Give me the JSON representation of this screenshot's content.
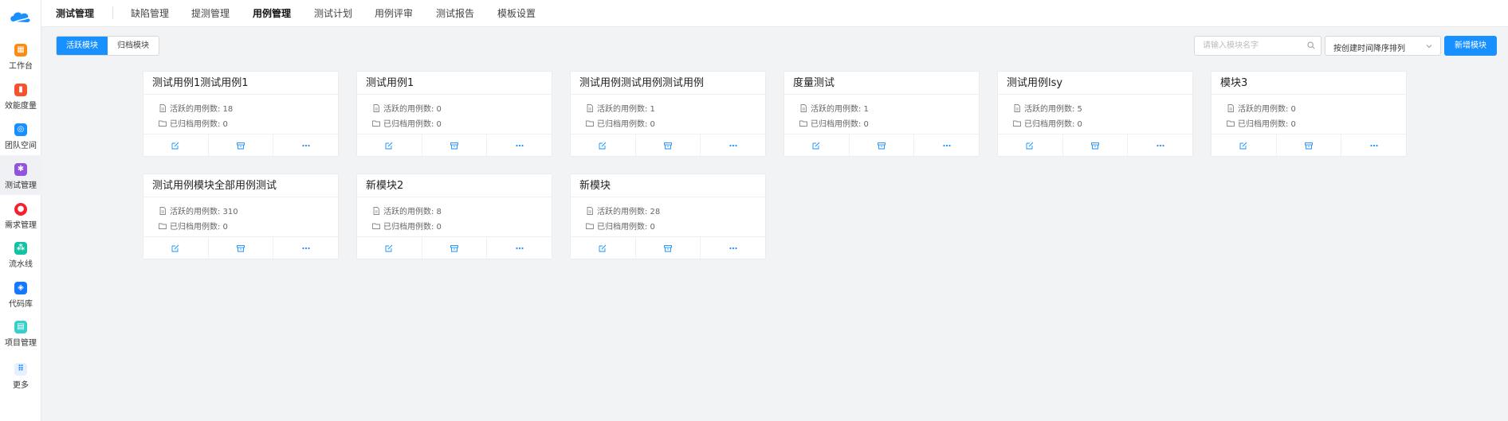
{
  "sidebar": {
    "items": [
      {
        "label": "工作台",
        "icon": "workbench-icon",
        "color": "#fa8c16",
        "glyph": "▦"
      },
      {
        "label": "效能度量",
        "icon": "metrics-icon",
        "color": "#f5532d",
        "glyph": "▮"
      },
      {
        "label": "团队空间",
        "icon": "team-space-icon",
        "color": "#1890ff",
        "glyph": "◎"
      },
      {
        "label": "测试管理",
        "icon": "test-management-icon",
        "color": "#9254de",
        "glyph": "✱"
      },
      {
        "label": "需求管理",
        "icon": "requirement-icon",
        "color": "#f5222d",
        "glyph": "●"
      },
      {
        "label": "流水线",
        "icon": "pipeline-icon",
        "color": "#13c2a3",
        "glyph": "⁂"
      },
      {
        "label": "代码库",
        "icon": "code-repo-icon",
        "color": "#1677ff",
        "glyph": "◈"
      },
      {
        "label": "项目管理",
        "icon": "project-icon",
        "color": "#36cfc9",
        "glyph": "▤"
      },
      {
        "label": "更多",
        "icon": "more-apps-icon",
        "color": "#e6f0ff",
        "glyph": "⠿"
      }
    ]
  },
  "header": {
    "title": "测试管理",
    "tabs": [
      "缺陷管理",
      "提测管理",
      "用例管理",
      "测试计划",
      "用例评审",
      "测试报告",
      "模板设置"
    ]
  },
  "toolbar": {
    "segments": [
      "活跃模块",
      "归档模块"
    ],
    "search_placeholder": "请输入模块名字",
    "sort_value": "按创建时间降序排列",
    "add_label": "新增模块"
  },
  "cards": [
    {
      "title": "测试用例1测试用例1",
      "active_count": "活跃的用例数: 18",
      "archived_count": "已归档用例数: 0"
    },
    {
      "title": "测试用例1",
      "active_count": "活跃的用例数: 0",
      "archived_count": "已归档用例数: 0"
    },
    {
      "title": "测试用例测试用例测试用例",
      "active_count": "活跃的用例数: 1",
      "archived_count": "已归档用例数: 0"
    },
    {
      "title": "度量测试",
      "active_count": "活跃的用例数: 1",
      "archived_count": "已归档用例数: 0"
    },
    {
      "title": "测试用例lsy",
      "active_count": "活跃的用例数: 5",
      "archived_count": "已归档用例数: 0"
    },
    {
      "title": "模块3",
      "active_count": "活跃的用例数: 0",
      "archived_count": "已归档用例数: 0"
    },
    {
      "title": "测试用例模块全部用例测试",
      "active_count": "活跃的用例数: 310",
      "archived_count": "已归档用例数: 0"
    },
    {
      "title": "新模块2",
      "active_count": "活跃的用例数: 8",
      "archived_count": "已归档用例数: 0"
    },
    {
      "title": "新模块",
      "active_count": "活跃的用例数: 28",
      "archived_count": "已归档用例数: 0"
    }
  ],
  "colors": {
    "accent": "#1890ff",
    "background": "#f2f3f5"
  }
}
